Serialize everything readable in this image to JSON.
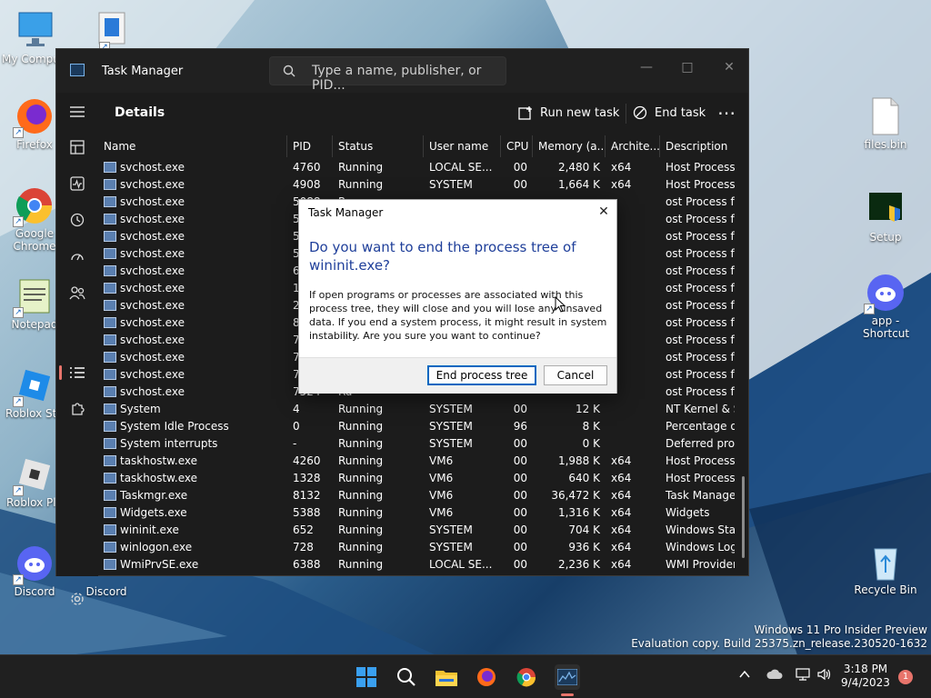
{
  "desktop": {
    "icons": [
      {
        "label": "My Compu"
      },
      {
        "label": ""
      },
      {
        "label": "Firefox"
      },
      {
        "label": "Google Chrome"
      },
      {
        "label": "Notepad"
      },
      {
        "label": "Roblox Stu"
      },
      {
        "label": "Roblox Pla"
      },
      {
        "label": "Discord"
      },
      {
        "label": "Discord"
      },
      {
        "label": "files.bin"
      },
      {
        "label": "Setup"
      },
      {
        "label": "app - Shortcut"
      },
      {
        "label": "Recycle Bin"
      }
    ],
    "watermark": {
      "line1": "Windows 11 Pro Insider Preview",
      "line2": "Evaluation copy. Build 25375.zn_release.230520-1632"
    }
  },
  "taskmanager": {
    "title": "Task Manager",
    "search_placeholder": "Type a name, publisher, or PID...",
    "page_title": "Details",
    "run_new_task": "Run new task",
    "end_task": "End task",
    "more": "⋯",
    "columns": [
      "Name",
      "PID",
      "Status",
      "User name",
      "CPU",
      "Memory (a...",
      "Archite...",
      "Description"
    ],
    "rows": [
      [
        "svchost.exe",
        "4760",
        "Running",
        "LOCAL SE...",
        "00",
        "2,480 K",
        "x64",
        "Host Process for Wind..."
      ],
      [
        "svchost.exe",
        "4908",
        "Running",
        "SYSTEM",
        "00",
        "1,664 K",
        "x64",
        "Host Process for Wind..."
      ],
      [
        "svchost.exe",
        "5088",
        "Ru",
        "",
        "",
        "",
        "",
        "ost Process for Wind..."
      ],
      [
        "svchost.exe",
        "5108",
        "Ru",
        "",
        "",
        "",
        "",
        "ost Process for Wind..."
      ],
      [
        "svchost.exe",
        "5416",
        "Ru",
        "",
        "",
        "",
        "",
        "ost Process for Wind..."
      ],
      [
        "svchost.exe",
        "5444",
        "Ru",
        "",
        "",
        "",
        "",
        "ost Process for Wind..."
      ],
      [
        "svchost.exe",
        "6104",
        "Ru",
        "",
        "",
        "",
        "",
        "ost Process for Wind..."
      ],
      [
        "svchost.exe",
        "1776",
        "Ru",
        "",
        "",
        "",
        "",
        "ost Process for Wind..."
      ],
      [
        "svchost.exe",
        "2808",
        "Ru",
        "",
        "",
        "",
        "",
        "ost Process for Wind..."
      ],
      [
        "svchost.exe",
        "8156",
        "Ru",
        "",
        "",
        "",
        "",
        "ost Process for Wind..."
      ],
      [
        "svchost.exe",
        "7408",
        "Ru",
        "",
        "",
        "",
        "",
        "ost Process for Wind..."
      ],
      [
        "svchost.exe",
        "7972",
        "Ru",
        "",
        "",
        "",
        "",
        "ost Process for Wind..."
      ],
      [
        "svchost.exe",
        "7936",
        "Ru",
        "",
        "",
        "",
        "",
        "ost Process for Wind..."
      ],
      [
        "svchost.exe",
        "7524",
        "Ru",
        "",
        "",
        "",
        "",
        "ost Process for Wind..."
      ],
      [
        "System",
        "4",
        "Running",
        "SYSTEM",
        "00",
        "12 K",
        "",
        "NT Kernel & System"
      ],
      [
        "System Idle Process",
        "0",
        "Running",
        "SYSTEM",
        "96",
        "8 K",
        "",
        "Percentage of time th..."
      ],
      [
        "System interrupts",
        "-",
        "Running",
        "SYSTEM",
        "00",
        "0 K",
        "",
        "Deferred procedure ca..."
      ],
      [
        "taskhostw.exe",
        "4260",
        "Running",
        "VM6",
        "00",
        "1,988 K",
        "x64",
        "Host Process for Wind..."
      ],
      [
        "taskhostw.exe",
        "1328",
        "Running",
        "VM6",
        "00",
        "640 K",
        "x64",
        "Host Process for Wind..."
      ],
      [
        "Taskmgr.exe",
        "8132",
        "Running",
        "VM6",
        "00",
        "36,472 K",
        "x64",
        "Task Manager"
      ],
      [
        "Widgets.exe",
        "5388",
        "Running",
        "VM6",
        "00",
        "1,316 K",
        "x64",
        "Widgets"
      ],
      [
        "wininit.exe",
        "652",
        "Running",
        "SYSTEM",
        "00",
        "704 K",
        "x64",
        "Windows Start-Up Ap..."
      ],
      [
        "winlogon.exe",
        "728",
        "Running",
        "SYSTEM",
        "00",
        "936 K",
        "x64",
        "Windows Logon Appli..."
      ],
      [
        "WmiPrvSE.exe",
        "6388",
        "Running",
        "LOCAL SE...",
        "00",
        "2,236 K",
        "x64",
        "WMI Provider Host"
      ]
    ]
  },
  "dialog": {
    "title": "Task Manager",
    "close": "✕",
    "heading": "Do you want to end the process tree of wininit.exe?",
    "body": "If open programs or processes are associated with this process tree, they will close and you will lose any unsaved data. If you end a system process, it might result in system instability. Are you sure you want to continue?",
    "primary_button": "End process tree",
    "cancel_button": "Cancel"
  },
  "taskbar": {
    "time": "3:18 PM",
    "date": "9/4/2023",
    "notification_count": "1"
  },
  "colors": {
    "accent": "#e8746b",
    "dialog_heading": "#1f3f9a",
    "tm_background": "#1c1c1c"
  }
}
